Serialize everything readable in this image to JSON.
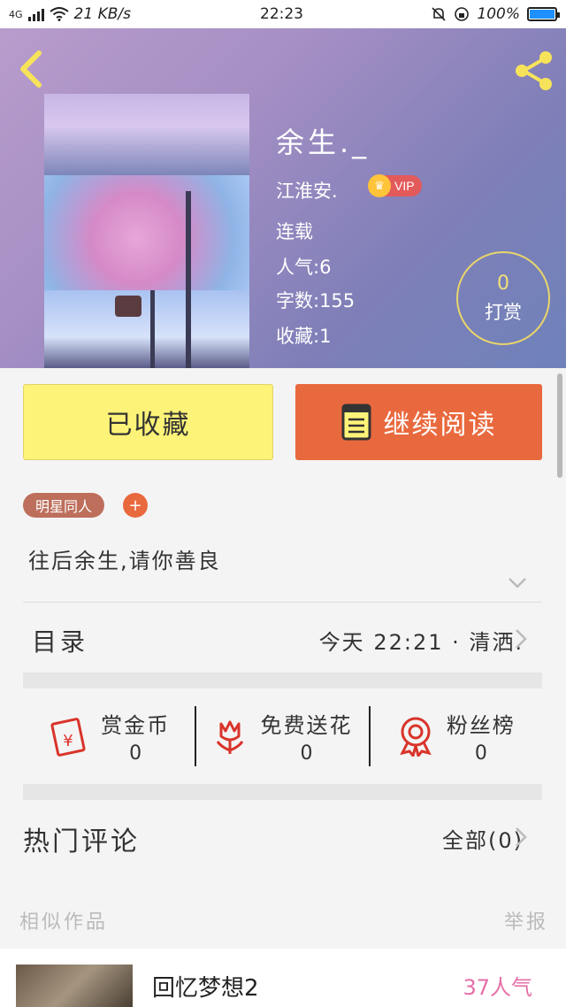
{
  "status_bar": {
    "network": "4G",
    "speed": "21 KB/s",
    "time": "22:23",
    "battery": "100%"
  },
  "book": {
    "title": "余生._",
    "author": "江淮安.",
    "vip_label": "VIP",
    "status": "连载",
    "popularity": "人气:6",
    "word_count": "字数:155",
    "collections": "收藏:1",
    "reward_count": "0",
    "reward_label": "打赏"
  },
  "actions": {
    "collected_label": "已收藏",
    "continue_label": "继续阅读"
  },
  "tags": {
    "items": [
      "明星同人"
    ],
    "add_label": "+"
  },
  "description": "往后余生,请你善良",
  "toc": {
    "label": "目录",
    "latest": "今天 22:21 · 清洒."
  },
  "stats": [
    {
      "name": "赏金币",
      "count": "0",
      "icon": "red-envelope-icon"
    },
    {
      "name": "免费送花",
      "count": "0",
      "icon": "flower-icon"
    },
    {
      "name": "粉丝榜",
      "count": "0",
      "icon": "medal-icon"
    }
  ],
  "comments": {
    "label": "热门评论",
    "all_label": "全部(0)"
  },
  "similar": {
    "label": "相似作品",
    "report_label": "举报",
    "items": [
      {
        "title": "回忆梦想2",
        "popularity": "37人气"
      }
    ]
  },
  "colors": {
    "accent": "#e9693e",
    "collected_bg": "#fdf378",
    "tag_bg": "#bd6f5c",
    "popularity_text": "#e66fa8"
  }
}
